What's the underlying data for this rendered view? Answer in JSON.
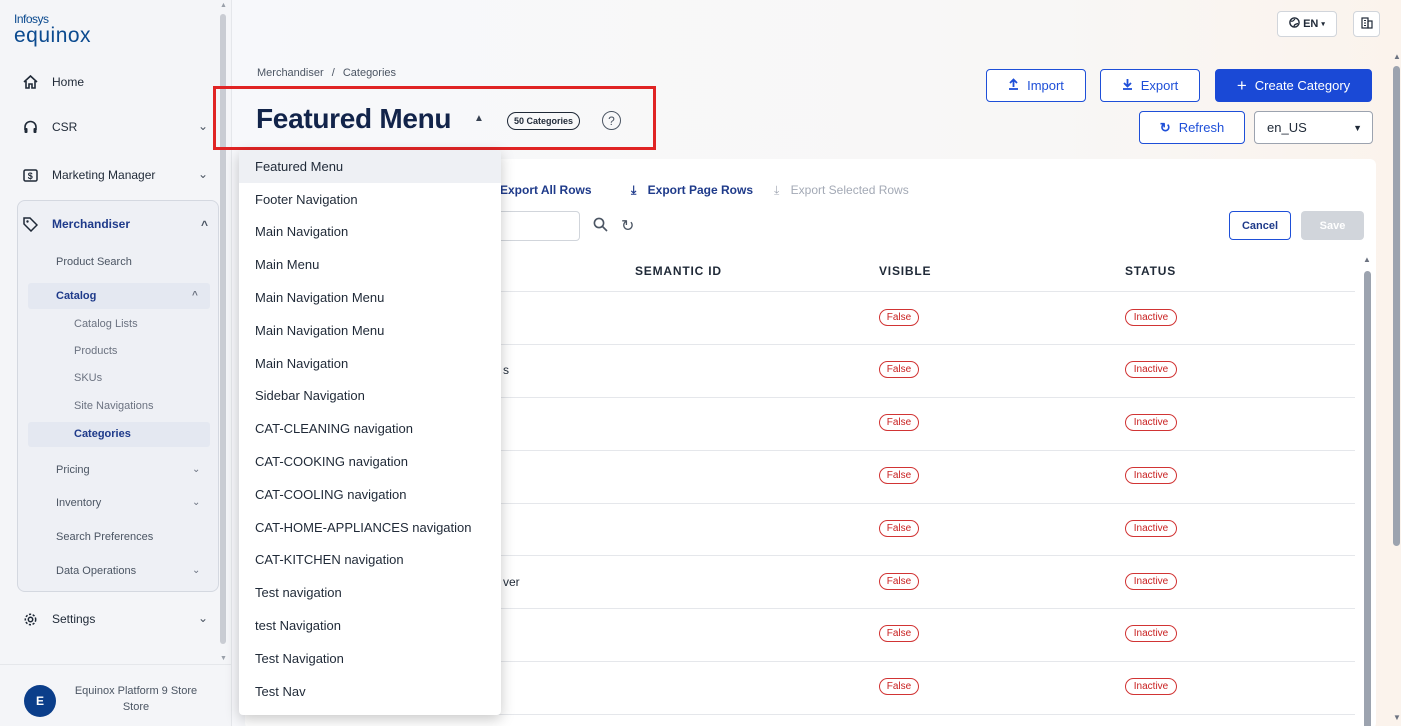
{
  "brand": {
    "line1": "Infosys",
    "line2": "equinox"
  },
  "sidebar": {
    "home": "Home",
    "csr": "CSR",
    "marketing": "Marketing Manager",
    "merchandiser": "Merchandiser",
    "product_search": "Product Search",
    "catalog": "Catalog",
    "catalog_lists": "Catalog Lists",
    "products": "Products",
    "skus": "SKUs",
    "site_navigations": "Site Navigations",
    "categories": "Categories",
    "pricing": "Pricing",
    "inventory": "Inventory",
    "search_preferences": "Search Preferences",
    "data_operations": "Data Operations",
    "settings": "Settings",
    "user_initial": "E",
    "user_line1": "Equinox Platform 9 Store",
    "user_line2": "Store"
  },
  "topbar": {
    "lang": "EN"
  },
  "header": {
    "breadcrumb_parent": "Merchandiser",
    "breadcrumb_sep": "/",
    "breadcrumb_current": "Categories",
    "title": "Featured Menu",
    "count_badge": "50 Categories",
    "help": "?",
    "import_label": "Import",
    "export_label": "Export",
    "create_label": "Create Category",
    "refresh_label": "Refresh",
    "locale_value": "en_US"
  },
  "toolbar": {
    "export_all": "Export All Rows",
    "export_page": "Export Page Rows",
    "export_selected": "Export Selected Rows",
    "cancel": "Cancel",
    "save": "Save"
  },
  "table": {
    "columns": [
      "SEMANTIC ID",
      "VISIBLE",
      "STATUS"
    ],
    "rows": [
      {
        "name_fragment": "",
        "visible": "False",
        "status": "Inactive"
      },
      {
        "name_fragment": "s",
        "visible": "False",
        "status": "Inactive"
      },
      {
        "name_fragment": "",
        "visible": "False",
        "status": "Inactive"
      },
      {
        "name_fragment": "",
        "visible": "False",
        "status": "Inactive"
      },
      {
        "name_fragment": "",
        "visible": "False",
        "status": "Inactive"
      },
      {
        "name_fragment": "ver",
        "visible": "False",
        "status": "Inactive"
      },
      {
        "name_fragment": "",
        "visible": "False",
        "status": "Inactive"
      },
      {
        "name_fragment": "",
        "visible": "False",
        "status": "Inactive"
      }
    ]
  },
  "dropdown": {
    "selected_index": 0,
    "options": [
      "Featured Menu",
      "Footer Navigation",
      "Main Navigation",
      "Main Menu",
      "Main Navigation Menu",
      "Main Navigation Menu",
      "Main Navigation",
      "Sidebar Navigation",
      "CAT-CLEANING navigation",
      "CAT-COOKING navigation",
      "CAT-COOLING navigation",
      "CAT-HOME-APPLIANCES navigation",
      "CAT-KITCHEN navigation",
      "Test navigation",
      "test Navigation",
      "Test Navigation",
      "Test Nav"
    ]
  },
  "colors": {
    "primary": "#1a49d6",
    "highlight": "#e02424",
    "status": "#c82020"
  }
}
